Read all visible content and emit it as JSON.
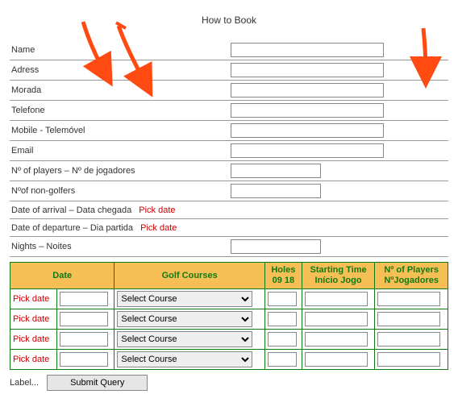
{
  "title": "How to Book",
  "fields": {
    "name": "Name",
    "adress": "Adress",
    "morada": "Morada",
    "telefone": "Telefone",
    "mobile": "Mobile - Telemóvel",
    "email": "Email",
    "num_players": "Nº of players – Nº de jogadores",
    "non_golfers": "Nºof non-golfers",
    "arrival": "Date of arrival – Data chegada",
    "departure": "Date of departure – Dia partida",
    "nights": "Nights – Noites"
  },
  "pick_date_label": "Pick date",
  "grid": {
    "headers": {
      "date": "Date",
      "courses": "Golf Courses",
      "holes_l1": "Holes",
      "holes_l2": "09 18",
      "start_l1": "Starting Time",
      "start_l2": "Início Jogo",
      "np_l1": "Nº of Players",
      "np_l2": "NºJogadores"
    },
    "select_placeholder": "Select Course",
    "row_count": 4
  },
  "submit": {
    "label_prefix": "Label...",
    "button": "Submit Query"
  }
}
